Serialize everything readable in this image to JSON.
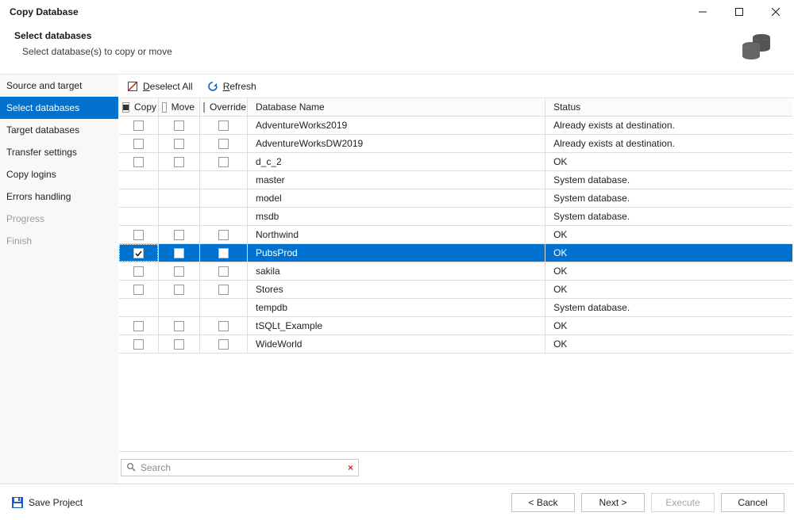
{
  "window": {
    "title": "Copy Database"
  },
  "header": {
    "title": "Select databases",
    "subtitle": "Select database(s) to copy or move"
  },
  "sidebar": {
    "steps": [
      {
        "label": "Source and target",
        "state": "normal"
      },
      {
        "label": "Select databases",
        "state": "active"
      },
      {
        "label": "Target databases",
        "state": "normal"
      },
      {
        "label": "Transfer settings",
        "state": "normal"
      },
      {
        "label": "Copy logins",
        "state": "normal"
      },
      {
        "label": "Errors handling",
        "state": "normal"
      },
      {
        "label": "Progress",
        "state": "disabled"
      },
      {
        "label": "Finish",
        "state": "disabled"
      }
    ]
  },
  "toolbar": {
    "deselect_pre": "D",
    "deselect_post": "eselect All",
    "refresh_pre": "R",
    "refresh_post": "efresh"
  },
  "grid": {
    "headers": {
      "copy": "Copy",
      "move": "Move",
      "override": "Override",
      "name": "Database Name",
      "status": "Status"
    },
    "header_state": {
      "copy": "indeterminate",
      "move": "unchecked",
      "override": "unchecked"
    },
    "rows": [
      {
        "name": "AdventureWorks2019",
        "status": "Already exists at destination.",
        "copy": "unchecked",
        "move": "unchecked",
        "override": "unchecked",
        "selected": false
      },
      {
        "name": "AdventureWorksDW2019",
        "status": "Already exists at destination.",
        "copy": "unchecked",
        "move": "unchecked",
        "override": "unchecked",
        "selected": false
      },
      {
        "name": "d_c_2",
        "status": "OK",
        "copy": "unchecked",
        "move": "unchecked",
        "override": "unchecked",
        "selected": false
      },
      {
        "name": "master",
        "status": "System database.",
        "copy": "none",
        "move": "none",
        "override": "none",
        "selected": false
      },
      {
        "name": "model",
        "status": "System database.",
        "copy": "none",
        "move": "none",
        "override": "none",
        "selected": false
      },
      {
        "name": "msdb",
        "status": "System database.",
        "copy": "none",
        "move": "none",
        "override": "none",
        "selected": false
      },
      {
        "name": "Northwind",
        "status": "OK",
        "copy": "unchecked",
        "move": "unchecked",
        "override": "unchecked",
        "selected": false
      },
      {
        "name": "PubsProd",
        "status": "OK",
        "copy": "checked",
        "move": "unchecked",
        "override": "unchecked",
        "selected": true
      },
      {
        "name": "sakila",
        "status": "OK",
        "copy": "unchecked",
        "move": "unchecked",
        "override": "unchecked",
        "selected": false
      },
      {
        "name": "Stores",
        "status": "OK",
        "copy": "unchecked",
        "move": "unchecked",
        "override": "unchecked",
        "selected": false
      },
      {
        "name": "tempdb",
        "status": "System database.",
        "copy": "none",
        "move": "none",
        "override": "none",
        "selected": false
      },
      {
        "name": "tSQLt_Example",
        "status": "OK",
        "copy": "unchecked",
        "move": "unchecked",
        "override": "unchecked",
        "selected": false
      },
      {
        "name": "WideWorld",
        "status": "OK",
        "copy": "unchecked",
        "move": "unchecked",
        "override": "unchecked",
        "selected": false
      }
    ]
  },
  "search": {
    "placeholder": "Search"
  },
  "footer": {
    "save": "Save Project",
    "back": "< Back",
    "next": "Next >",
    "execute": "Execute",
    "cancel": "Cancel"
  }
}
